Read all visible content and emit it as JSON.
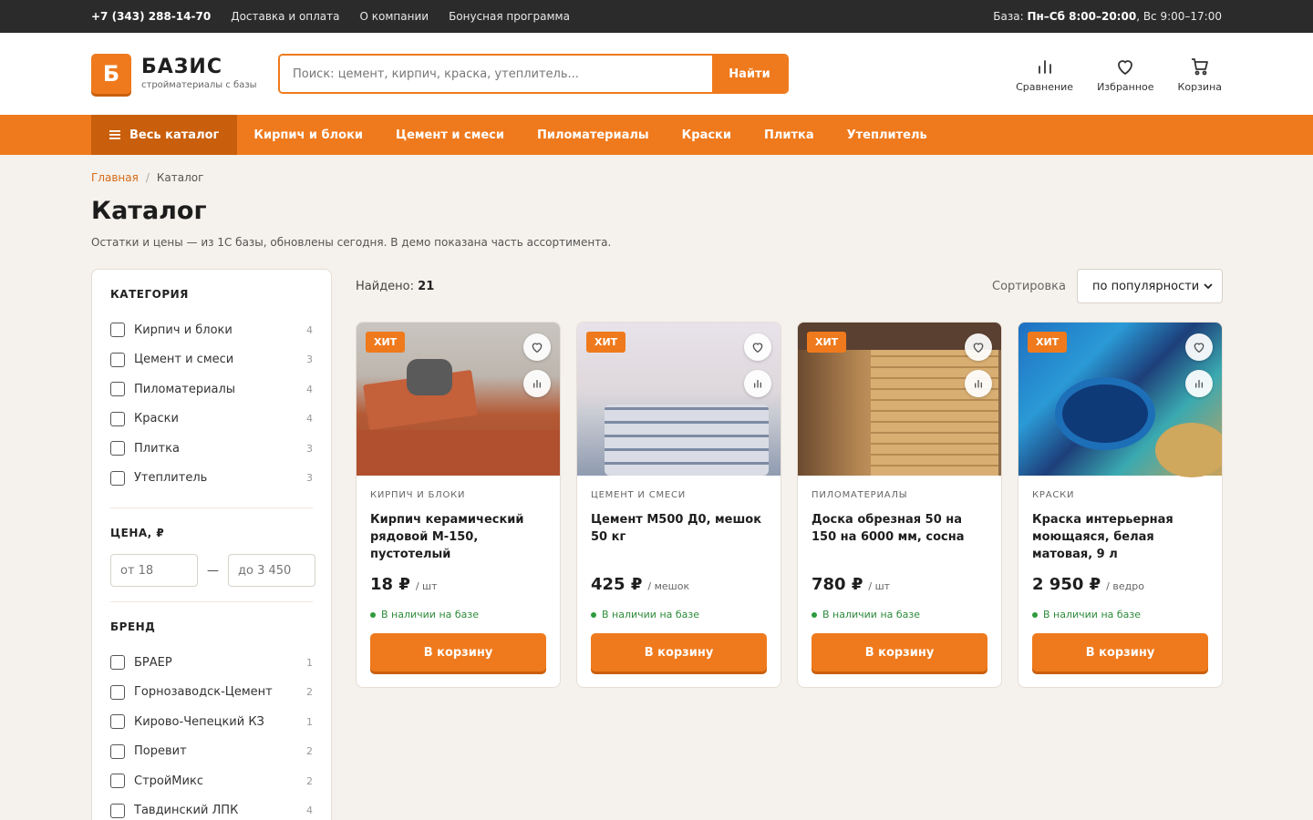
{
  "topbar": {
    "phone": "+7 (343) 288-14-70",
    "links": [
      "Доставка и оплата",
      "О компании",
      "Бонусная программа"
    ],
    "hours_prefix": "База: ",
    "hours_bold": "Пн–Сб 8:00–20:00",
    "hours_rest": ", Вс 9:00–17:00"
  },
  "header": {
    "logo_letter": "Б",
    "logo_name": "БАЗИС",
    "logo_sub": "стройматериалы с базы",
    "search_placeholder": "Поиск: цемент, кирпич, краска, утеплитель...",
    "search_button": "Найти",
    "icons": [
      {
        "label": "Сравнение",
        "icon": "compare-icon"
      },
      {
        "label": "Избранное",
        "icon": "heart-icon"
      },
      {
        "label": "Корзина",
        "icon": "cart-icon"
      }
    ]
  },
  "nav": {
    "catalog": "Весь каталог",
    "items": [
      "Кирпич и блоки",
      "Цемент и смеси",
      "Пиломатериалы",
      "Краски",
      "Плитка",
      "Утеплитель"
    ]
  },
  "breadcrumb": {
    "home": "Главная",
    "sep": "/",
    "current": "Каталог"
  },
  "page": {
    "title": "Каталог",
    "subtitle": "Остатки и цены — из 1С базы, обновлены сегодня. В демо показана часть ассортимента."
  },
  "filters": {
    "category_title": "КАТЕГОРИЯ",
    "categories": [
      {
        "label": "Кирпич и блоки",
        "count": "4"
      },
      {
        "label": "Цемент и смеси",
        "count": "3"
      },
      {
        "label": "Пиломатериалы",
        "count": "4"
      },
      {
        "label": "Краски",
        "count": "4"
      },
      {
        "label": "Плитка",
        "count": "3"
      },
      {
        "label": "Утеплитель",
        "count": "3"
      }
    ],
    "price_title": "ЦЕНА, ₽",
    "price_from": "от 18",
    "price_to": "до 3 450",
    "price_dash": "—",
    "brand_title": "БРЕНД",
    "brands": [
      {
        "label": "БРАЕР",
        "count": "1"
      },
      {
        "label": "Горнозаводск-Цемент",
        "count": "2"
      },
      {
        "label": "Кирово-Чепецкий КЗ",
        "count": "1"
      },
      {
        "label": "Поревит",
        "count": "2"
      },
      {
        "label": "СтройМикс",
        "count": "2"
      },
      {
        "label": "Тавдинский ЛПК",
        "count": "4"
      }
    ]
  },
  "toolbar": {
    "found_label": "Найдено: ",
    "found_count": "21",
    "sort_label": "Сортировка",
    "sort_value": "по популярности"
  },
  "products": [
    {
      "badge": "ХИТ",
      "category": "КИРПИЧ И БЛОКИ",
      "name": "Кирпич керамический рядовой М-150, пустотелый",
      "price": "18 ₽",
      "unit": "/ шт",
      "stock": "В наличии на базе",
      "button": "В корзину"
    },
    {
      "badge": "ХИТ",
      "category": "ЦЕМЕНТ И СМЕСИ",
      "name": "Цемент М500 Д0, мешок 50 кг",
      "price": "425 ₽",
      "unit": "/ мешок",
      "stock": "В наличии на базе",
      "button": "В корзину"
    },
    {
      "badge": "ХИТ",
      "category": "ПИЛОМАТЕРИАЛЫ",
      "name": "Доска обрезная 50 на 150 на 6000 мм, сосна",
      "price": "780 ₽",
      "unit": "/ шт",
      "stock": "В наличии на базе",
      "button": "В корзину"
    },
    {
      "badge": "ХИТ",
      "category": "КРАСКИ",
      "name": "Краска интерьерная моющаяся, белая матовая, 9 л",
      "price": "2 950 ₽",
      "unit": "/ ведро",
      "stock": "В наличии на базе",
      "button": "В корзину"
    }
  ],
  "colors": {
    "accent": "#ef7a1d",
    "accent_dark": "#c95f0c",
    "stock_green": "#2e8b3a"
  }
}
